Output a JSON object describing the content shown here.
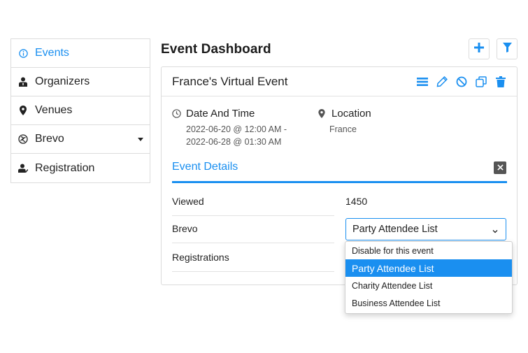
{
  "sidebar": {
    "items": [
      {
        "label": "Events",
        "icon": "info-circle-icon",
        "active": true
      },
      {
        "label": "Organizers",
        "icon": "user-tie-icon",
        "active": false
      },
      {
        "label": "Venues",
        "icon": "map-pin-icon",
        "active": false
      },
      {
        "label": "Brevo",
        "icon": "brevo-logo-icon",
        "active": false
      },
      {
        "label": "Registration",
        "icon": "user-register-icon",
        "active": false
      }
    ]
  },
  "header": {
    "title": "Event Dashboard",
    "add_icon": "plus-icon",
    "filter_icon": "filter-icon"
  },
  "event": {
    "title": "France's Virtual Event",
    "actions": [
      "list-icon",
      "edit-icon",
      "cancel-icon",
      "copy-icon",
      "delete-icon"
    ],
    "date_label": "Date And Time",
    "date_line1": "2022-06-20 @ 12:00 AM -",
    "date_line2": "2022-06-28 @ 01:30 AM",
    "location_label": "Location",
    "location_value": "France"
  },
  "details": {
    "title": "Event Details",
    "rows": [
      {
        "label": "Viewed",
        "value": "1450"
      },
      {
        "label": "Brevo",
        "value": "Party Attendee List"
      },
      {
        "label": "Registrations",
        "value": ""
      }
    ]
  },
  "brevo_select": {
    "selected": "Party Attendee List",
    "options": [
      "Disable for this event",
      "Party Attendee List",
      "Charity Attendee List",
      "Business Attendee List"
    ]
  },
  "colors": {
    "accent": "#1a8ff0",
    "text": "#222222",
    "border": "#dcdcdc"
  }
}
